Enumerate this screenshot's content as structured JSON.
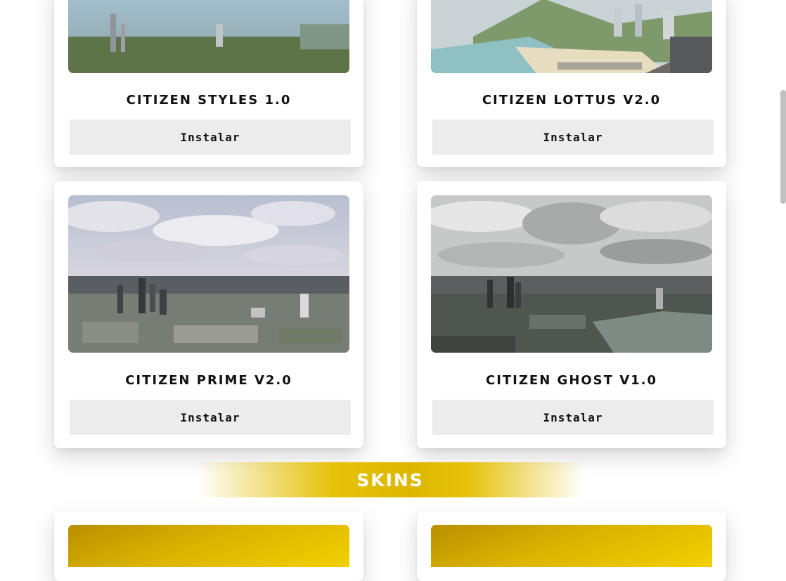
{
  "mods": [
    {
      "title": "CITIZEN STYLES 1.0",
      "button_label": "Instalar"
    },
    {
      "title": "CITIZEN LOTTUS V2.0",
      "button_label": "Instalar"
    },
    {
      "title": "CITIZEN PRIME V2.0",
      "button_label": "Instalar"
    },
    {
      "title": "CITIZEN GHOST V1.0",
      "button_label": "Instalar"
    }
  ],
  "section": {
    "title": "SKINS"
  },
  "colors": {
    "accent": "#e6c20a",
    "button_bg": "#ececec"
  }
}
